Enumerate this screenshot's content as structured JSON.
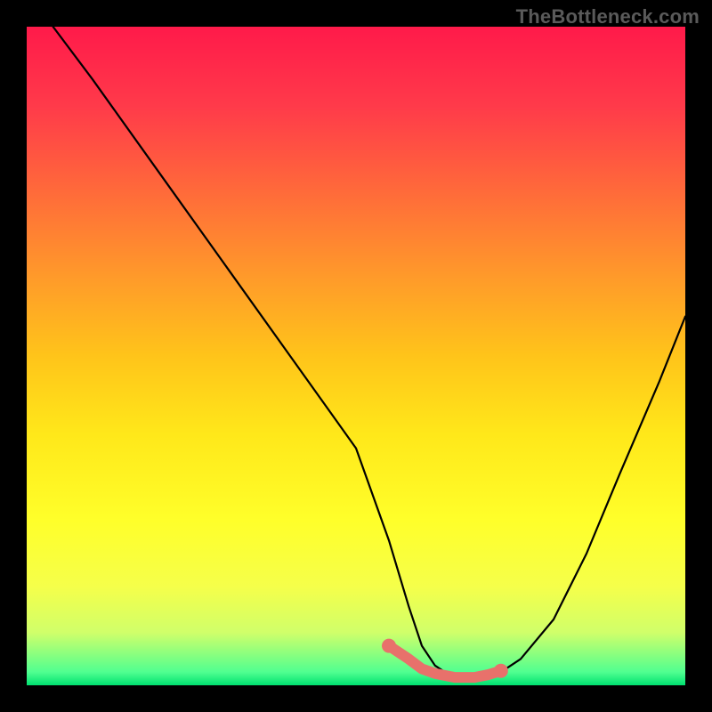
{
  "watermark": "TheBottleneck.com",
  "chart_data": {
    "type": "line",
    "title": "",
    "xlabel": "",
    "ylabel": "",
    "xlim": [
      0,
      100
    ],
    "ylim": [
      0,
      100
    ],
    "series": [
      {
        "name": "curve",
        "x": [
          4,
          10,
          20,
          30,
          40,
          50,
          55,
          58,
          60,
          62,
          65,
          68,
          70,
          72,
          75,
          80,
          85,
          90,
          96,
          100
        ],
        "y": [
          100,
          92,
          78,
          64,
          50,
          36,
          22,
          12,
          6,
          3,
          1,
          1,
          1,
          2,
          4,
          10,
          20,
          32,
          46,
          56
        ]
      }
    ],
    "highlight_segment": {
      "color": "#e8716b",
      "x": [
        55,
        58,
        60,
        62,
        65,
        68,
        70,
        72
      ],
      "y": [
        6,
        4,
        2.5,
        1.8,
        1.2,
        1.2,
        1.6,
        2.2
      ]
    },
    "highlight_dots": {
      "color": "#e8716b",
      "x": [
        55,
        72
      ],
      "y": [
        6,
        2.2
      ]
    }
  }
}
